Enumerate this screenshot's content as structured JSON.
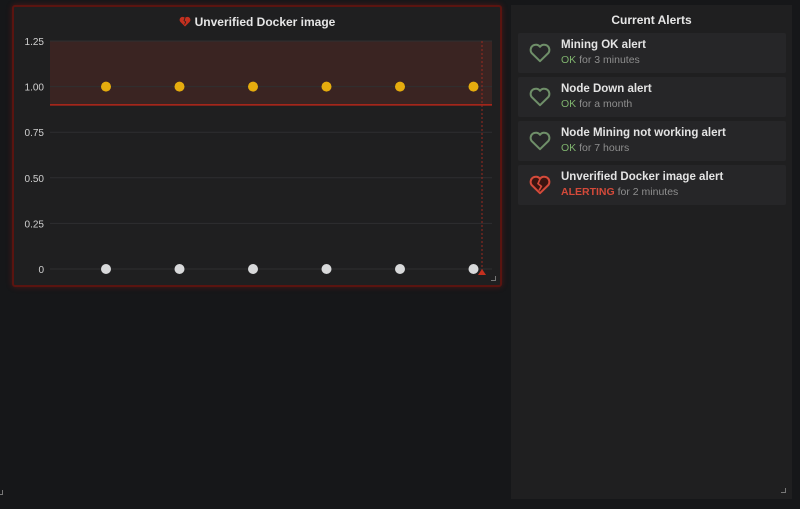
{
  "graph_panel": {
    "title": "Unverified Docker image",
    "state": "alerting"
  },
  "chart_data": {
    "type": "scatter",
    "title": "Unverified Docker image",
    "ylim": [
      0,
      1.25
    ],
    "y_ticks": [
      "1.25",
      "1.00",
      "0.75",
      "0.50",
      "0.25",
      "0"
    ],
    "y_tick_values": [
      1.25,
      1.0,
      0.75,
      0.5,
      0.25,
      0
    ],
    "threshold": 0.9,
    "grid": true,
    "series": [
      {
        "values": [
          1,
          1,
          1,
          1,
          1,
          1
        ],
        "color": "#e5ac0e"
      },
      {
        "values": [
          0,
          0,
          0,
          0,
          0,
          0
        ],
        "color": "#d8d9da"
      }
    ]
  },
  "alerts_panel": {
    "title": "Current Alerts",
    "items": [
      {
        "name": "Mining OK alert",
        "state": "OK",
        "duration": "for 3 minutes",
        "status": "ok"
      },
      {
        "name": "Node Down alert",
        "state": "OK",
        "duration": "for a month",
        "status": "ok"
      },
      {
        "name": "Node Mining not working alert",
        "state": "OK",
        "duration": "for 7 hours",
        "status": "ok"
      },
      {
        "name": "Unverified Docker image alert",
        "state": "ALERTING",
        "duration": "for 2 minutes",
        "status": "alerting"
      }
    ]
  },
  "colors": {
    "ok": "#7eb26d",
    "alerting": "#d44a3a",
    "series_yellow": "#e5ac0e",
    "threshold_fill": "#3a2422"
  }
}
